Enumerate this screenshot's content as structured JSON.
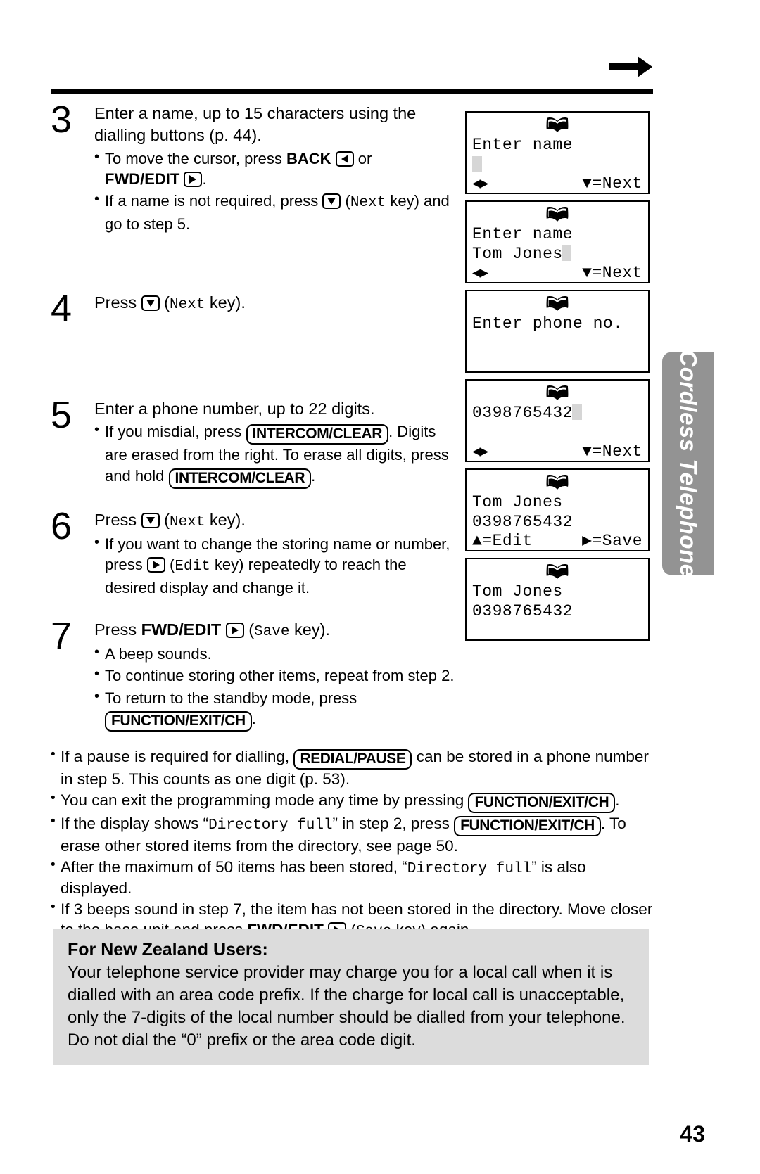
{
  "page": {
    "number": "43",
    "side_tab_label": "Cordless Telephone",
    "nav_arrow_icon": "right-arrow-icon"
  },
  "steps": [
    {
      "number": "3",
      "title_part1": "Enter a name, up to 15 characters using the dialling buttons (p. 44).",
      "bullets": [
        {
          "id": "move-cursor",
          "pre": "To move the cursor, press ",
          "key_label_1": "BACK",
          "key_icon_1": "left-arrow-key-icon",
          "mid": " or ",
          "key_label_2": "FWD/EDIT",
          "key_icon_2": "right-arrow-key-icon",
          "post": "."
        },
        {
          "id": "skip-name",
          "pre": "If a name is not required, press ",
          "key_icon_1": "down-arrow-key-icon",
          "mono": "Next",
          "post": " key) and go to step 5."
        }
      ]
    },
    {
      "number": "4",
      "title_pre": "Press ",
      "title_key_icon": "down-arrow-key-icon",
      "title_mono": "Next",
      "title_post": " key)."
    },
    {
      "number": "5",
      "title_part1": "Enter a phone number, up to 22 digits.",
      "bullets": [
        {
          "id": "misdial",
          "pre": "If you misdial, press ",
          "btn_1": "INTERCOM/CLEAR",
          "mid": ". Digits are erased from the right. To erase all digits, press and hold ",
          "btn_2": "INTERCOM/CLEAR",
          "post": "."
        }
      ]
    },
    {
      "number": "6",
      "title_pre": "Press ",
      "title_key_icon": "down-arrow-key-icon",
      "title_mono": "Next",
      "title_post": " key).",
      "bullets": [
        {
          "id": "change-storing",
          "pre": "If you want to change the storing name or number, press ",
          "key_icon_1": "right-arrow-key-icon",
          "mono": "Edit",
          "post": " key) repeatedly to reach the desired display and change it."
        }
      ]
    },
    {
      "number": "7",
      "title_pre": "Press ",
      "title_bold": "FWD/EDIT",
      "title_key_icon": "right-arrow-key-icon",
      "title_mono": "Save",
      "title_post": " key).",
      "bullets": [
        {
          "id": "beep",
          "text": "A beep sounds."
        },
        {
          "id": "continue",
          "text": "To continue storing other items, repeat from step 2."
        },
        {
          "id": "standby",
          "pre": "To return to the standby mode, press ",
          "btn_1": "FUNCTION/EXIT/CH",
          "post": "."
        }
      ]
    }
  ],
  "lcds": [
    {
      "id": "enter-name-empty",
      "icon": "directory-book-icon",
      "line1": "Enter name",
      "line2": "",
      "line2_cursor": true,
      "line3": "",
      "foot_left": "◀▶",
      "foot_right": "▼=Next"
    },
    {
      "id": "enter-name-tom-jones",
      "icon": "directory-book-icon",
      "line1": "Enter name",
      "line2": "Tom Jones",
      "line2_cursor": true,
      "foot_left": "◀▶",
      "foot_right": "▼=Next"
    },
    {
      "id": "enter-phone-no",
      "icon": "directory-book-icon",
      "line1": "Enter phone no.",
      "line2": "",
      "line3": "",
      "foot_left": "",
      "foot_right": ""
    },
    {
      "id": "phone-number-entered",
      "icon": "directory-book-icon",
      "line1": "0398765432",
      "line1_cursor": true,
      "line2": "",
      "foot_left": "◀▶",
      "foot_right": "▼=Next"
    },
    {
      "id": "confirm-edit-save",
      "icon": "directory-book-icon",
      "line1": "Tom Jones",
      "line2": "0398765432",
      "foot_left": "▲=Edit",
      "foot_right": "▶=Save"
    },
    {
      "id": "stored-item",
      "icon": "directory-book-icon",
      "line1": "Tom Jones",
      "line2": "0398765432",
      "line3": "",
      "foot_left": "",
      "foot_right": ""
    }
  ],
  "notes": [
    {
      "id": "pause-note",
      "pre": "If a pause is required for dialling, ",
      "btn_1": "REDIAL/PAUSE",
      "post": " can be stored in a phone number in step 5. This counts as one digit (p. 53)."
    },
    {
      "id": "exit-programming",
      "pre": "You can exit the programming mode any time by pressing ",
      "btn_1": "FUNCTION/EXIT/CH",
      "post": "."
    },
    {
      "id": "directory-full-step2",
      "pre": "If the display shows “",
      "mono": "Directory full",
      "mid": "” in step 2, press ",
      "btn_1": "FUNCTION/EXIT/CH",
      "post": ". To erase other stored items from the directory, see page 50."
    },
    {
      "id": "max-50-items",
      "pre": "After the maximum of 50 items has been stored, “",
      "mono": "Directory full",
      "post": "” is also displayed."
    },
    {
      "id": "three-beeps",
      "pre": "If 3 beeps sound in step 7, the item has not been stored in the directory. Move closer to the base unit and press ",
      "bold": "FWD/EDIT",
      "key_icon_1": "right-arrow-key-icon",
      "mono": "Save",
      "post": " key) again."
    }
  ],
  "nz_box": {
    "title": "For New Zealand Users:",
    "body": "Your telephone service provider may charge you for a local call when it is dialled with an area code prefix. If the charge for local call is unacceptable, only the 7-digits of the local number should be dialled from your telephone. Do not dial the “0” prefix or the area code digit."
  },
  "colors": {
    "side_tab_bg": "#939393",
    "nz_box_bg": "#dcdcdc",
    "cursor_block": "#d6d6d6",
    "ink": "#000000"
  }
}
